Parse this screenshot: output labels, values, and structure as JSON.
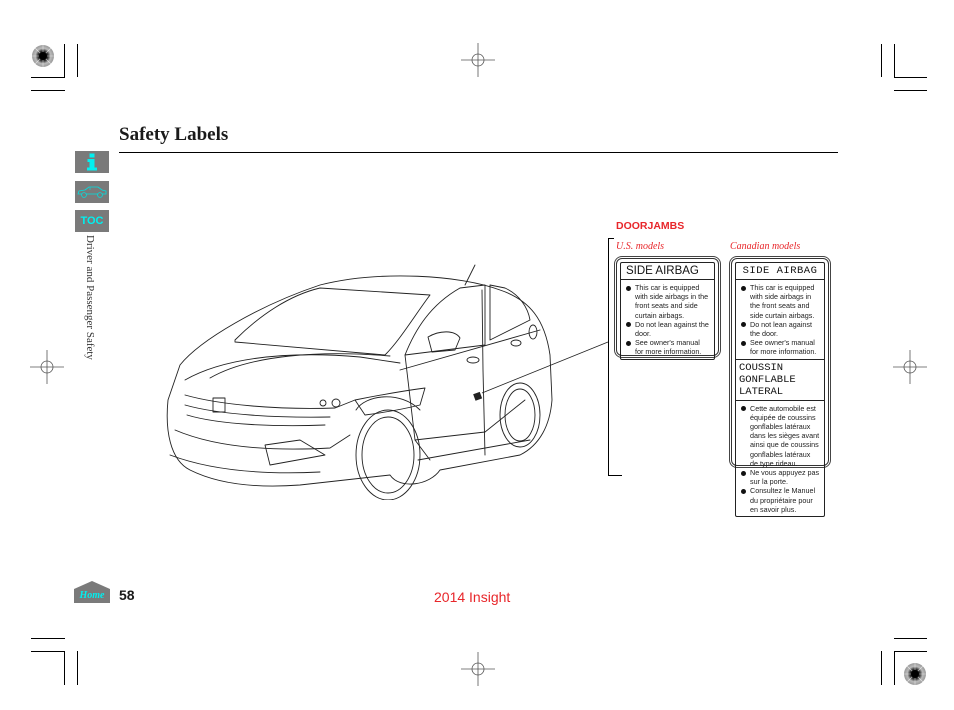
{
  "page": {
    "title": "Safety Labels",
    "section": "Driver and Passenger Safety",
    "page_number": "58",
    "model_footer": "2014 Insight"
  },
  "sidebar": {
    "info_icon": "info-icon",
    "car_icon": "car-icon",
    "toc_label": "TOC",
    "home_label": "Home"
  },
  "figure": {
    "location_heading": "DOORJAMBS",
    "us_label_caption": "U.S. models",
    "ca_label_caption": "Canadian models",
    "us_label": {
      "heading": "SIDE AIRBAG",
      "items": [
        "This car is equipped with side airbags in the front seats and side curtain airbags.",
        "Do not lean against the door.",
        "See owner's manual for more information."
      ]
    },
    "ca_label": {
      "heading_en": "SIDE AIRBAG",
      "items_en": [
        "This car is equipped with side airbags in the front seats and side curtain airbags.",
        "Do not lean against the door.",
        "See owner's manual for more information."
      ],
      "heading_fr": "COUSSIN  GONFLABLE LATERAL",
      "items_fr": [
        "Cette automobile est équipée de coussins gonflables latéraux dans les sièges avant ainsi que de coussins gonflables latéraux de type rideau.",
        "Ne vous appuyez pas sur la porte.",
        "Consultez le Manuel du propriétaire pour en savoir plus."
      ]
    }
  },
  "colors": {
    "accent_red": "#e8262a",
    "nav_cyan": "#00f0f0",
    "nav_gray": "#7a7a7a"
  }
}
